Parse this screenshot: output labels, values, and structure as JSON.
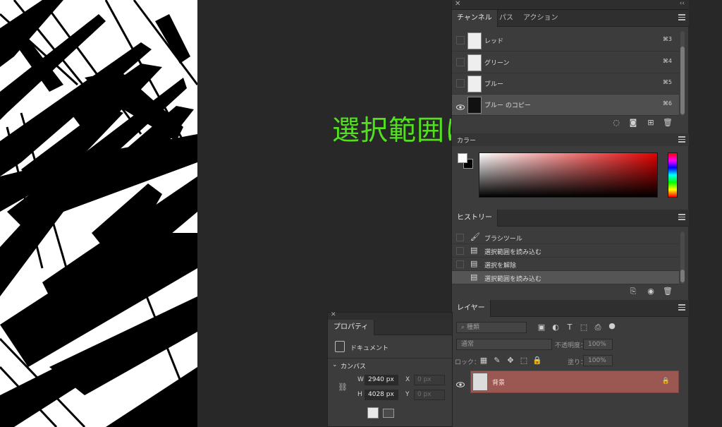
{
  "channels_panel": {
    "tabs": [
      "チャンネル",
      "パス",
      "アクション"
    ],
    "rows": [
      {
        "name": "レッド",
        "shortcut": "⌘3"
      },
      {
        "name": "グリーン",
        "shortcut": "⌘4"
      },
      {
        "name": "ブルー",
        "shortcut": "⌘5"
      },
      {
        "name": "ブルー のコピー",
        "shortcut": "⌘6"
      }
    ]
  },
  "annotation": {
    "text": "選択範囲にする",
    "color": "#52e020"
  },
  "color_panel": {
    "title": "カラー",
    "foreground": "#ffffff",
    "background": "#000000"
  },
  "history_panel": {
    "title": "ヒストリー",
    "items": [
      {
        "label": "ブラシツール",
        "icon": "brush-icon"
      },
      {
        "label": "選択範囲を読み込む",
        "icon": "document-icon"
      },
      {
        "label": "選択を解除",
        "icon": "document-icon"
      },
      {
        "label": "選択範囲を読み込む",
        "icon": "document-icon"
      }
    ]
  },
  "layers_panel": {
    "title": "レイヤー",
    "search_placeholder": "種類",
    "blend_mode": "通常",
    "opacity_label": "不透明度：",
    "opacity_value": "100%",
    "lock_label": "ロック：",
    "fill_label": "塗り：",
    "fill_value": "100%",
    "layers": [
      {
        "name": "背景",
        "locked": true,
        "color": "#9b5853"
      }
    ]
  },
  "properties_panel": {
    "title": "プロパティ",
    "doc_label": "ドキュメント",
    "canvas_label": "カンバス",
    "w_label": "W",
    "w_value": "2940 px",
    "h_label": "H",
    "h_value": "4028 px",
    "x_label": "X",
    "x_placeholder": "0 px",
    "y_label": "Y",
    "y_placeholder": "0 px"
  }
}
